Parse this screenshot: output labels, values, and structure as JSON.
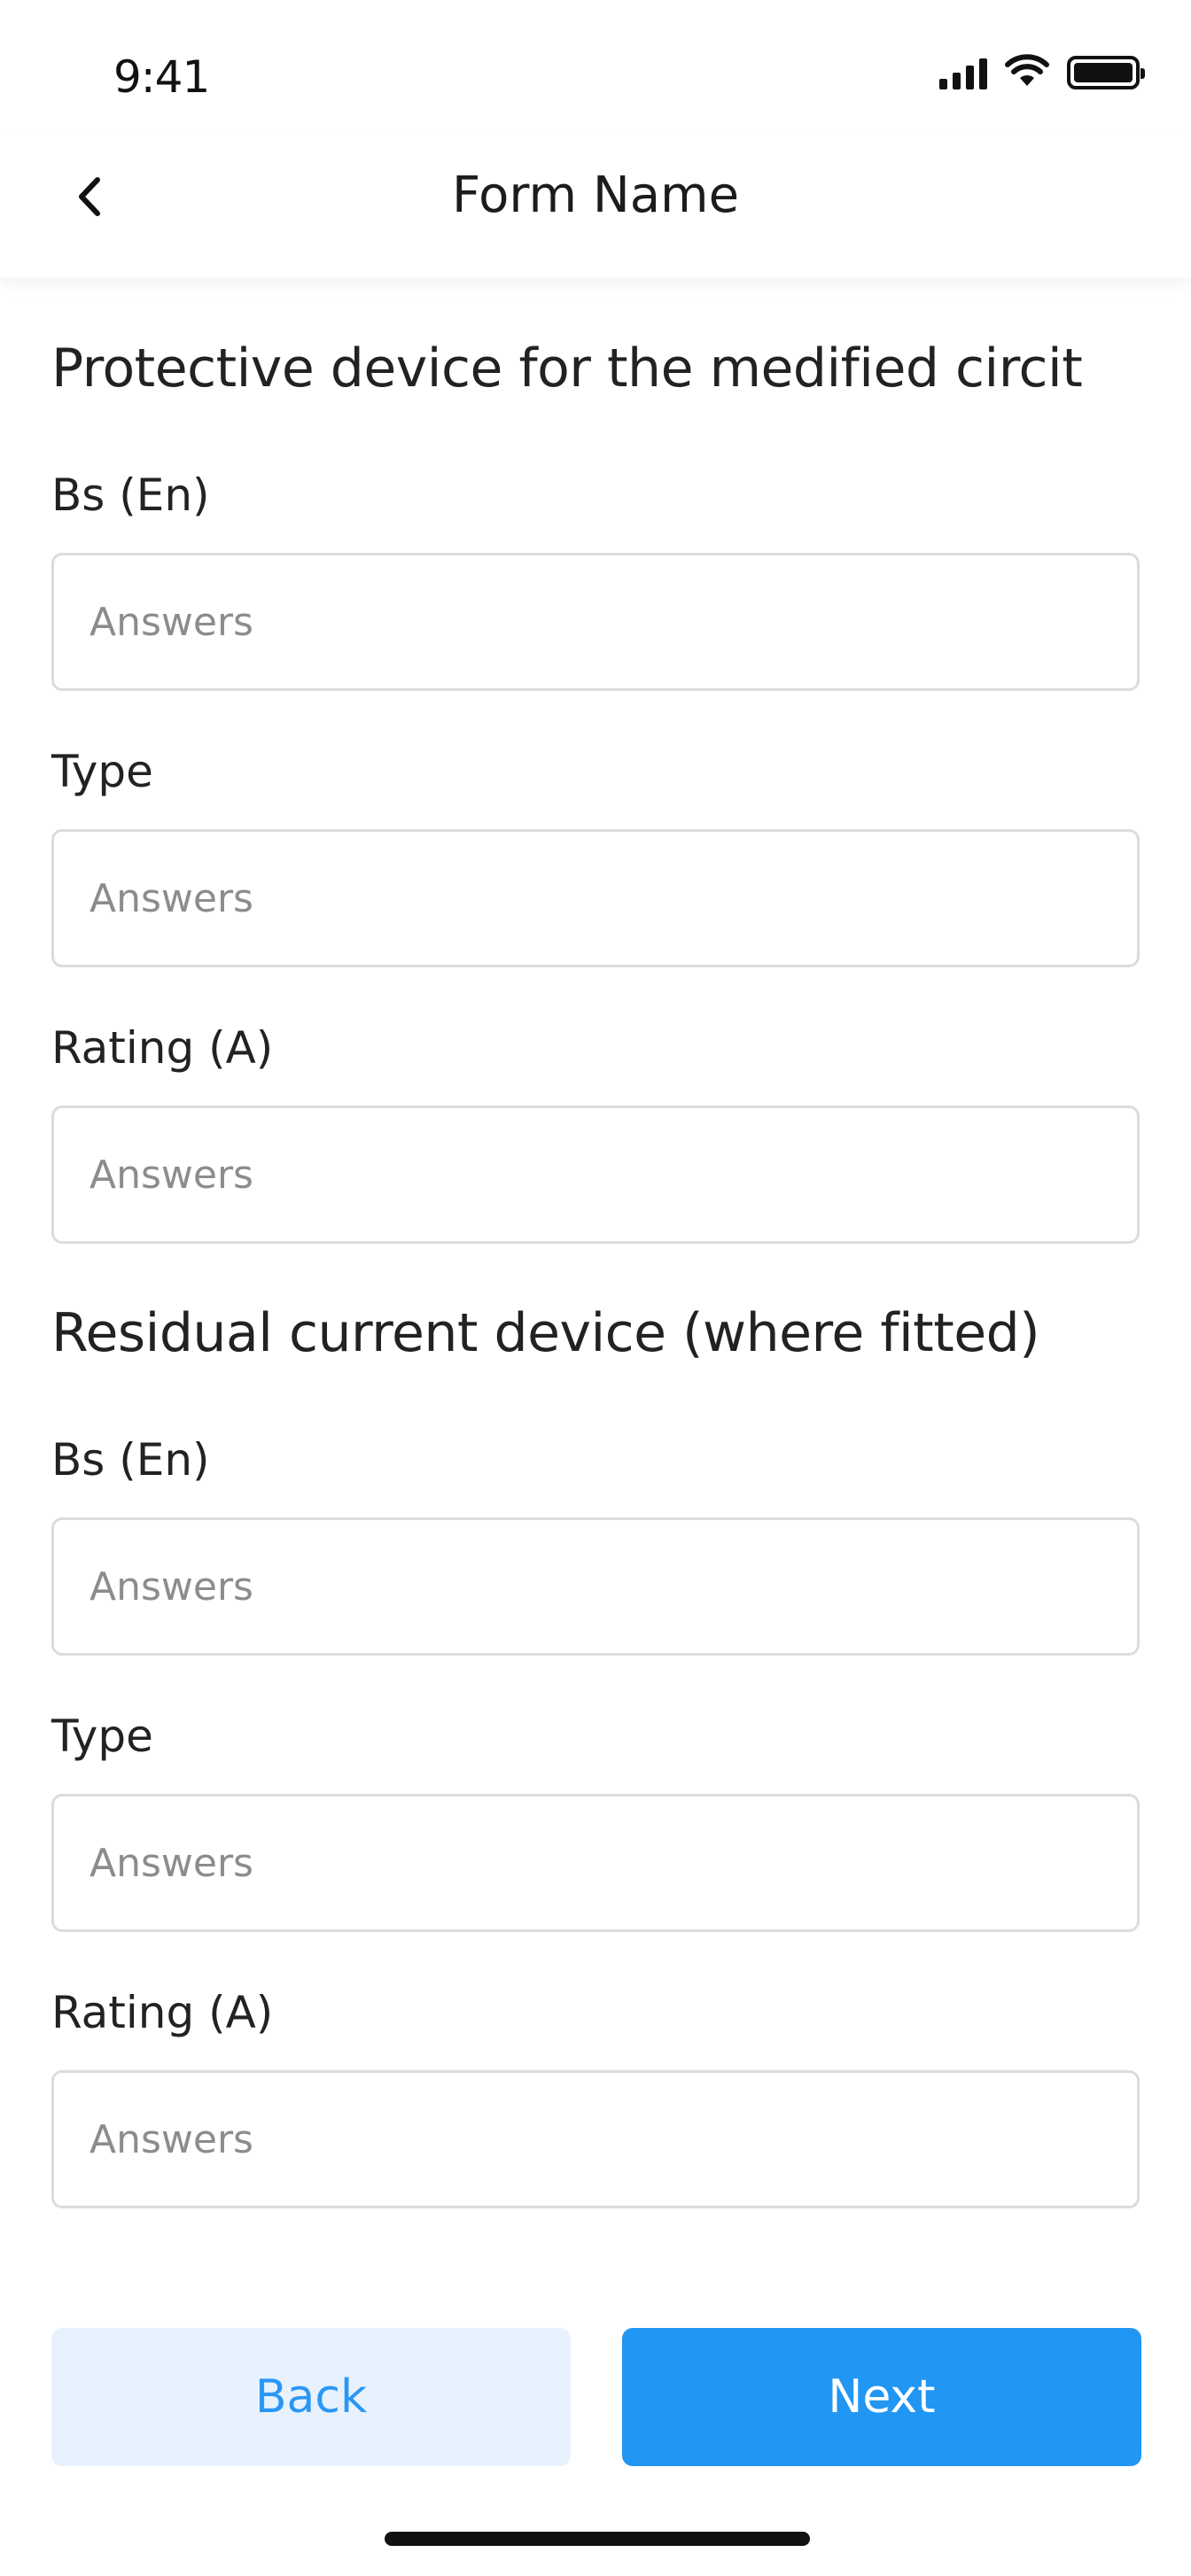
{
  "status_bar": {
    "time": "9:41",
    "icons": [
      "signal-icon",
      "wifi-icon",
      "battery-icon"
    ]
  },
  "header": {
    "back_icon": "chevron-left-icon",
    "title": "Form Name"
  },
  "sections": [
    {
      "title": "Protective device for the medified circit",
      "fields": [
        {
          "label": "Bs (En)",
          "value": "",
          "placeholder": "Answers"
        },
        {
          "label": "Type",
          "value": "",
          "placeholder": "Answers"
        },
        {
          "label": "Rating (A)",
          "value": "",
          "placeholder": "Answers"
        }
      ]
    },
    {
      "title": "Residual current device (where fitted)",
      "fields": [
        {
          "label": "Bs (En)",
          "value": "",
          "placeholder": "Answers"
        },
        {
          "label": "Type",
          "value": "",
          "placeholder": "Answers"
        },
        {
          "label": "Rating (A)",
          "value": "",
          "placeholder": "Answers"
        }
      ]
    }
  ],
  "actions": {
    "back_label": "Back",
    "next_label": "Next"
  },
  "colors": {
    "primary": "#2196f3",
    "secondary_bg": "#e7f2fe",
    "secondary_text": "#2b97f4",
    "input_border": "#dcdcdc",
    "placeholder": "#8c8c8c"
  }
}
